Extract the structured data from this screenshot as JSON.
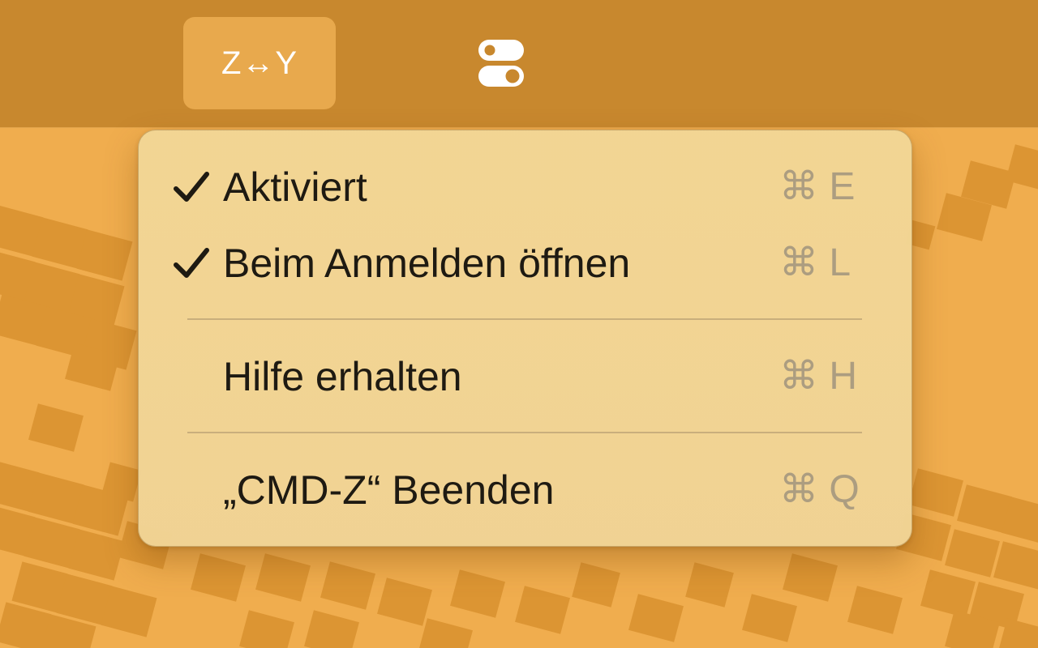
{
  "statusbar": {
    "app_label": "Z↔Y",
    "toggle_icon": "toggle-switches-icon"
  },
  "menu": {
    "items": [
      {
        "label": "Aktiviert",
        "checked": true,
        "shortcut": "⌘ E"
      },
      {
        "label": "Beim Anmelden öffnen",
        "checked": true,
        "shortcut": "⌘ L"
      },
      {
        "label": "Hilfe erhalten",
        "checked": false,
        "shortcut": "⌘ H"
      },
      {
        "label": "„CMD-Z“ Beenden",
        "checked": false,
        "shortcut": "⌘ Q"
      }
    ]
  },
  "colors": {
    "menubar": "#c8882e",
    "wallpaper": "#f0ad4e",
    "tile": "#d8902f",
    "menu_background": "#f1d596",
    "active_status_item": "#e8a94d",
    "shortcut_text": "#ac9d80"
  }
}
